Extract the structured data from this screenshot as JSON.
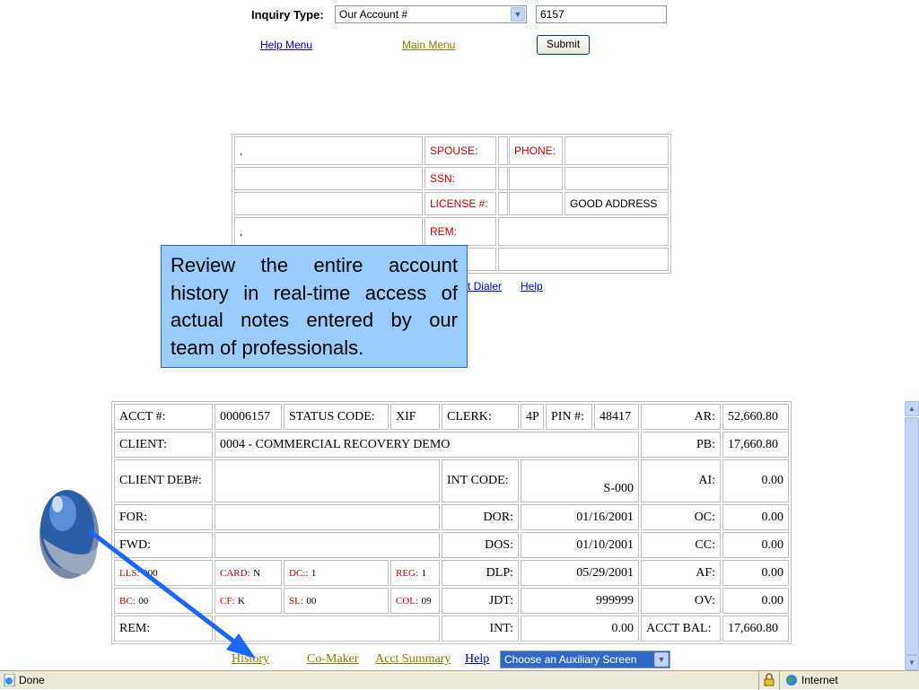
{
  "inquiry": {
    "label": "Inquiry Type:",
    "type_value": "Our Account #",
    "account_value": "6157",
    "submit_label": "Submit",
    "help_menu": "Help Menu",
    "main_menu": "Main Menu"
  },
  "debtor": {
    "row1_name": ",",
    "spouse_label": "SPOUSE:",
    "phone_label": "PHONE:",
    "ssn_label": "SSN:",
    "license_label": "LICENSE #:",
    "address_status": "GOOD ADDRESS",
    "row4_name": ",",
    "rem_label": "REM:",
    "links": {
      "dialer": "t Dialer",
      "help": "Help"
    }
  },
  "callout": {
    "text": "Review the entire account history in real-time access of actual notes entered by our team of professionals."
  },
  "account": {
    "acct_label": "ACCT #:",
    "acct_value": "00006157",
    "status_label": "STATUS CODE:",
    "status_value": "XIF",
    "clerk_label": "CLERK:",
    "clerk_value": "4P",
    "pin_label": "PIN #:",
    "pin_value": "48417",
    "ar_label": "AR:",
    "ar_value": "52,660.80",
    "client_label": "CLIENT:",
    "client_value": "0004 - COMMERCIAL RECOVERY DEMO",
    "pb_label": "PB:",
    "pb_value": "17,660.80",
    "client_deb_label": "CLIENT DEB#:",
    "int_code_label": "INT CODE:",
    "int_code_value": "S-000",
    "ai_label": "AI:",
    "ai_value": "0.00",
    "for_label": "FOR:",
    "dor_label": "DOR:",
    "dor_value": "01/16/2001",
    "oc_label": "OC:",
    "oc_value": "0.00",
    "fwd_label": "FWD:",
    "dos_label": "DOS:",
    "dos_value": "01/10/2001",
    "cc_label": "CC:",
    "cc_value": "0.00",
    "lls_label": "LLS:",
    "lls_value": "000",
    "card_label": "CARD:",
    "card_value": "N",
    "dc_label": "DC::",
    "dc_value": "1",
    "reg_label": "REG:",
    "reg_value": "1",
    "dlp_label": "DLP:",
    "dlp_value": "05/29/2001",
    "af_label": "AF:",
    "af_value": "0.00",
    "bc_label": "BC:",
    "bc_value": "00",
    "cf_label": "CF:",
    "cf_value": "K",
    "sl_label": "SL:",
    "sl_value": "00",
    "col_label": "COL:",
    "col_value": "09",
    "jdt_label": "JDT:",
    "jdt_value": "999999",
    "ov_label": "OV:",
    "ov_value": "0.00",
    "rem_label": "REM:",
    "int_label": "INT:",
    "int_value": "0.00",
    "acct_bal_label": "ACCT BAL:",
    "acct_bal_value": "17,660.80"
  },
  "bottom_links": {
    "history": "History",
    "comaker": "Co-Maker",
    "acct_summary": "Acct Summary",
    "help": "Help",
    "aux_select": "Choose an Auxiliary Screen"
  },
  "statusbar": {
    "done": "Done",
    "zone": "Internet"
  },
  "colors": {
    "callout_bg": "#99ccff",
    "arrow": "#1a66ff",
    "label_red": "#cc0000"
  }
}
